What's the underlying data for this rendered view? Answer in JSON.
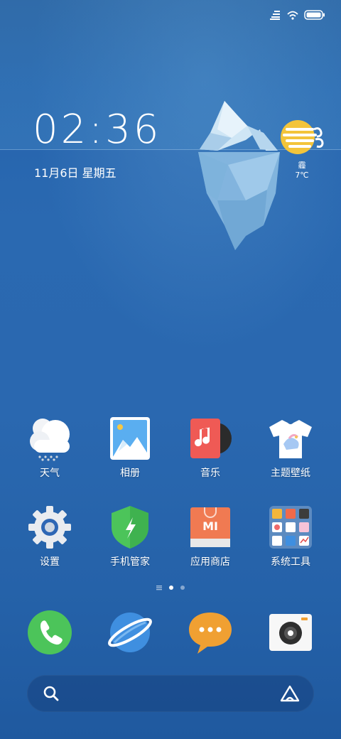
{
  "clock": {
    "time": "02:36",
    "date": "11月6日 星期五"
  },
  "weather": {
    "condition": "霾",
    "temperature": "7℃"
  },
  "apps_row1": [
    {
      "label": "天气",
      "icon": "weather-cloud-icon"
    },
    {
      "label": "相册",
      "icon": "gallery-icon"
    },
    {
      "label": "音乐",
      "icon": "music-icon"
    },
    {
      "label": "主题壁纸",
      "icon": "themes-icon"
    }
  ],
  "apps_row2": [
    {
      "label": "设置",
      "icon": "settings-gear-icon"
    },
    {
      "label": "手机管家",
      "icon": "security-shield-icon"
    },
    {
      "label": "应用商店",
      "icon": "app-store-icon"
    },
    {
      "label": "系统工具",
      "icon": "tools-folder-icon"
    }
  ],
  "dock": [
    {
      "icon": "phone-icon"
    },
    {
      "icon": "browser-planet-icon"
    },
    {
      "icon": "messages-icon"
    },
    {
      "icon": "camera-icon"
    }
  ],
  "page_indicator": {
    "pages": 2,
    "current": 1
  },
  "colors": {
    "accent_green": "#4cc45a",
    "accent_orange": "#f0a032",
    "accent_red": "#ef5a55",
    "browser_blue": "#3f8fe0"
  }
}
